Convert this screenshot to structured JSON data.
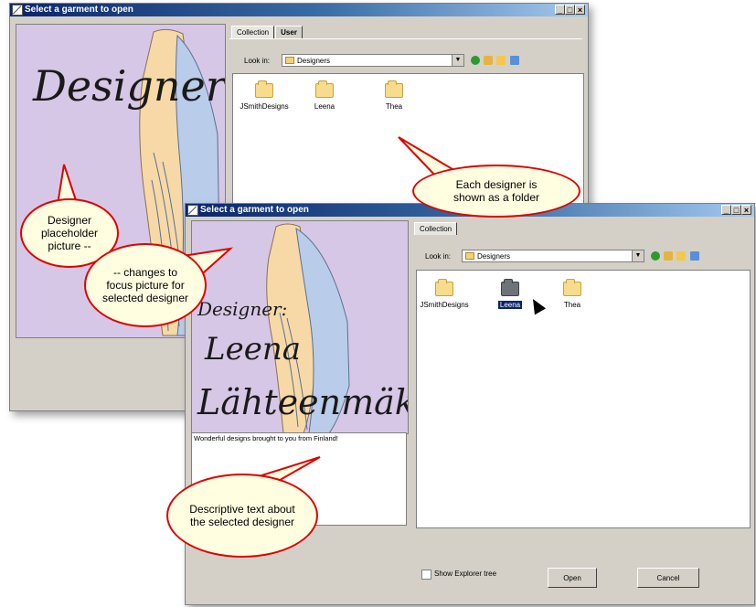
{
  "window_back": {
    "title": "Select a garment to open",
    "picture_word": "Designer",
    "tabs": [
      "Collection",
      "User"
    ],
    "look_in_label": "Look in:",
    "look_in_value": "Designers",
    "folders": [
      "JSmithDesigns",
      "Leena",
      "Thea"
    ]
  },
  "window_front": {
    "title": "Select a garment to open",
    "picture_lines": [
      "Designer:",
      "Leena",
      "Lähteenmäki"
    ],
    "tabs": [
      "Collection"
    ],
    "look_in_label": "Look in:",
    "look_in_value": "Designers",
    "folders": [
      "JSmithDesigns",
      "Leena",
      "Thea"
    ],
    "description": "Wonderful designs brought to you from Finland!",
    "show_tree_label": "Show Explorer tree",
    "open_label": "Open",
    "cancel_label": "Cancel"
  },
  "callouts": {
    "folder": "Each designer is shown as a folder",
    "placeholder": "Designer placeholder picture --",
    "focus": "-- changes to focus picture for selected designer",
    "description": "Descriptive text about the selected designer"
  },
  "colors": {
    "picture_bg": "#d7c7e6",
    "callout_border": "#e00000",
    "callout_fill": "#fffee0"
  }
}
